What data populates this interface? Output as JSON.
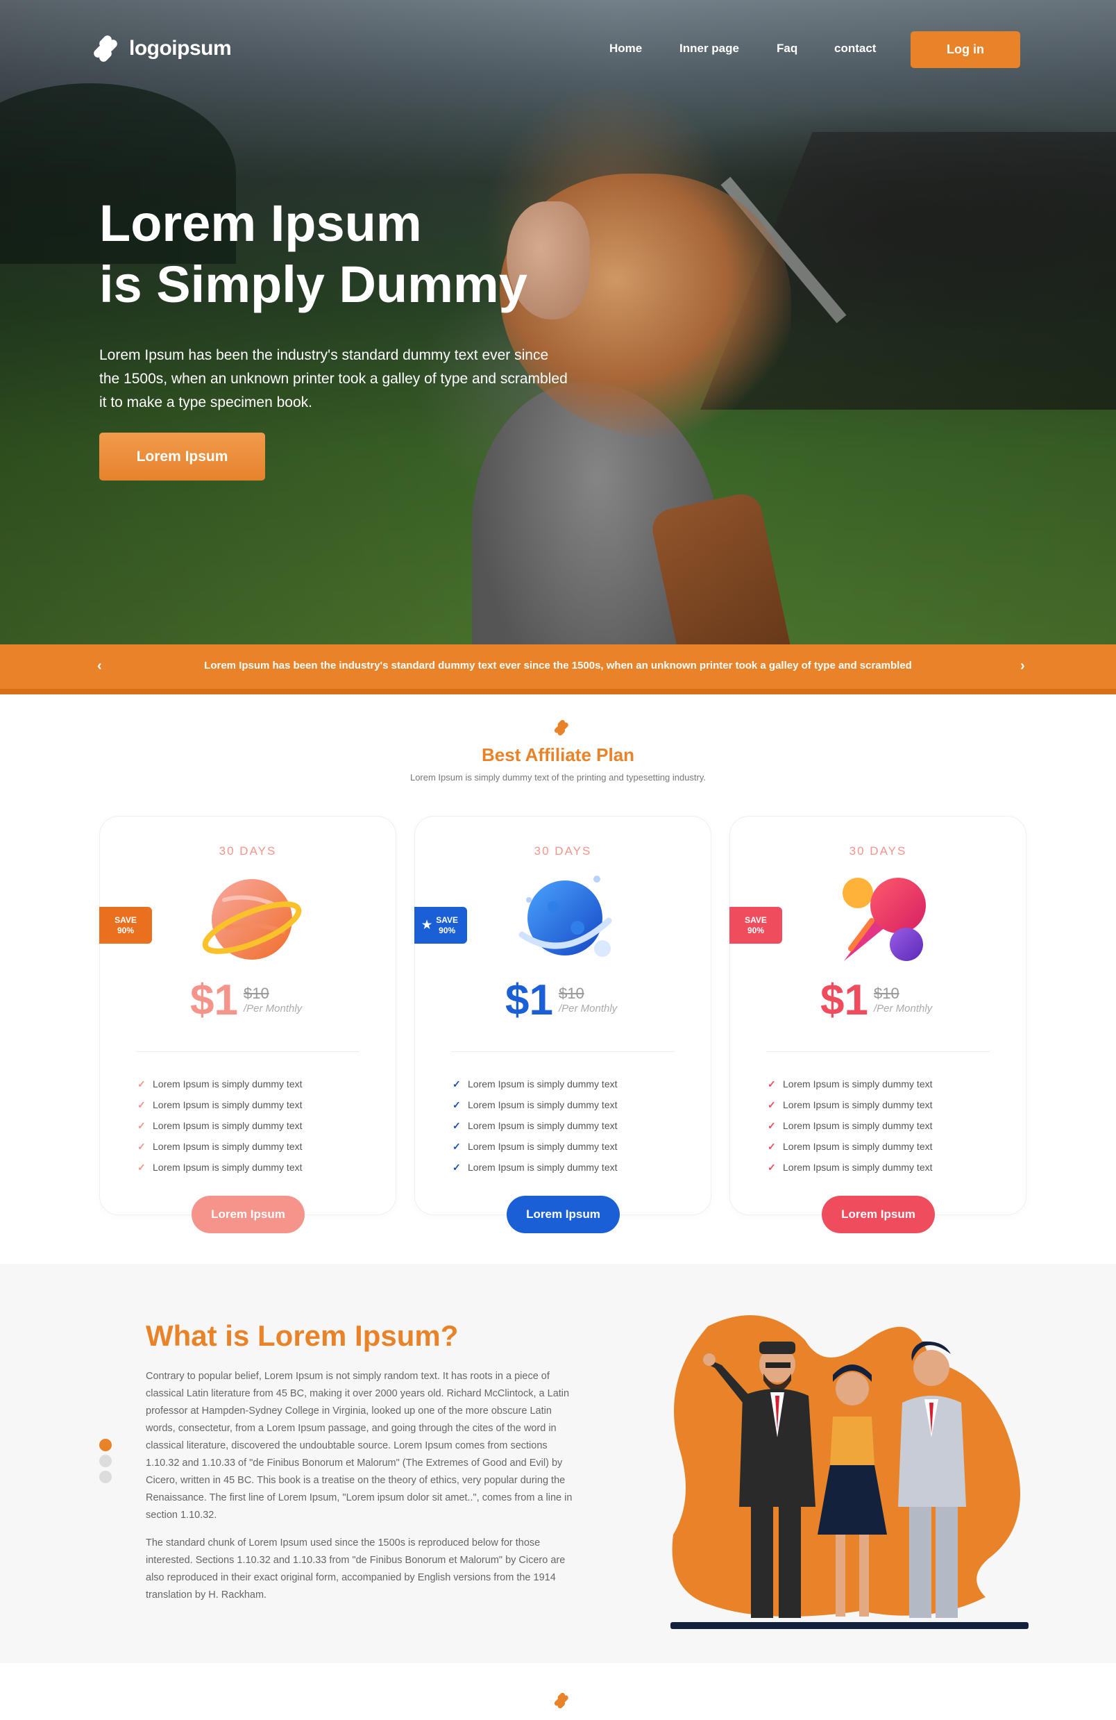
{
  "nav": {
    "logo_text": "logoipsum",
    "links": [
      "Home",
      "Inner page",
      "Faq",
      "contact"
    ],
    "login_label": "Log in"
  },
  "hero": {
    "title_line1": "Lorem Ipsum",
    "title_line2": "is Simply Dummy",
    "description": "Lorem Ipsum has been the industry's standard dummy text ever since the 1500s, when an unknown printer took a galley of type and scrambled it to make a type specimen book.",
    "button_label": "Lorem Ipsum"
  },
  "banner": {
    "text": "Lorem Ipsum has been the industry's standard dummy text ever since the 1500s, when an unknown printer took a galley of type and scrambled",
    "prev": "‹",
    "next": "›"
  },
  "plans": {
    "title": "Best Affiliate Plan",
    "subtitle": "Lorem Ipsum is simply dummy text of the printing and typesetting industry.",
    "cards": [
      {
        "days": "30 DAYS",
        "badge": "SAVE 90%",
        "price": "$1",
        "old_price": "$10",
        "period": "/Per Monthly",
        "features": [
          "Lorem Ipsum is simply dummy text",
          "Lorem Ipsum is simply dummy text",
          "Lorem Ipsum is simply dummy text",
          "Lorem Ipsum is simply dummy text",
          "Lorem Ipsum is simply dummy text"
        ],
        "button": "Lorem Ipsum",
        "accent": "#f4948a",
        "badge_color": "#e8701f",
        "icon": "planet-icon"
      },
      {
        "days": "30 DAYS",
        "badge": "SAVE 90%",
        "price": "$1",
        "old_price": "$10",
        "period": "/Per Monthly",
        "features": [
          "Lorem Ipsum is simply dummy text",
          "Lorem Ipsum is simply dummy text",
          "Lorem Ipsum is simply dummy text",
          "Lorem Ipsum is simply dummy text",
          "Lorem Ipsum is simply dummy text"
        ],
        "button": "Lorem Ipsum",
        "accent": "#1a5fd6",
        "badge_color": "#1a5fd6",
        "icon": "planet-icon"
      },
      {
        "days": "30 DAYS",
        "badge": "SAVE 90%",
        "price": "$1",
        "old_price": "$10",
        "period": "/Per Monthly",
        "features": [
          "Lorem Ipsum is simply dummy text",
          "Lorem Ipsum is simply dummy text",
          "Lorem Ipsum is simply dummy text",
          "Lorem Ipsum is simply dummy text",
          "Lorem Ipsum is simply dummy text"
        ],
        "button": "Lorem Ipsum",
        "accent": "#ef4c5e",
        "badge_color": "#ef4c5e",
        "icon": "comet-icon"
      }
    ]
  },
  "what": {
    "title": "What is Lorem Ipsum?",
    "paragraph1": "Contrary to popular belief, Lorem Ipsum is not simply random text. It has roots in a piece of classical Latin literature from 45 BC, making it over 2000 years old. Richard McClintock, a Latin professor at Hampden-Sydney College in Virginia, looked up one of the more obscure Latin words, consectetur, from a Lorem Ipsum passage, and going through the cites of the word in classical literature, discovered the undoubtable source. Lorem Ipsum comes from sections 1.10.32 and 1.10.33 of \"de Finibus Bonorum et Malorum\" (The Extremes of Good and Evil) by Cicero, written in 45 BC. This book is a treatise on the theory of ethics, very popular during the Renaissance. The first line of Lorem Ipsum, \"Lorem ipsum dolor sit amet..\", comes from a line in section 1.10.32.",
    "paragraph2": "The standard chunk of Lorem Ipsum used since the 1500s is reproduced below for those interested. Sections 1.10.32 and 1.10.33 from \"de Finibus Bonorum et Malorum\" by Cicero are also reproduced in their exact original form, accompanied by English versions from the 1914 translation by H. Rackham."
  },
  "colors": {
    "brand_orange": "#e8832a",
    "blue": "#1a5fd6",
    "red": "#ef4c5e",
    "salmon": "#f4948a"
  }
}
